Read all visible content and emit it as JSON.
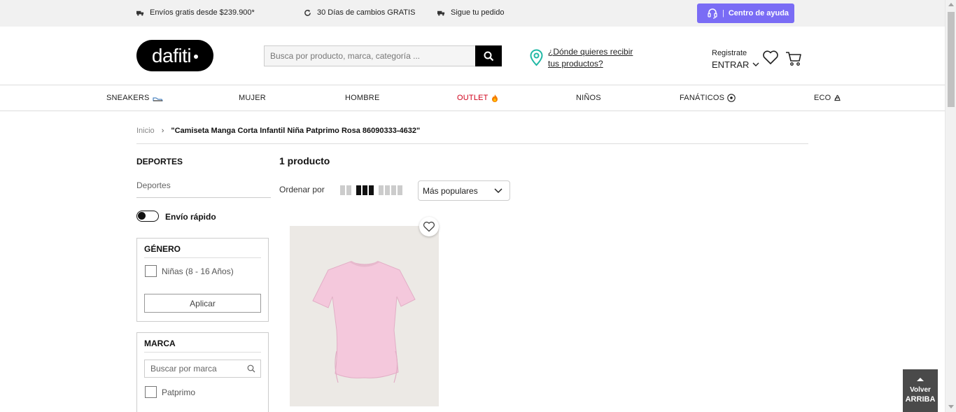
{
  "topbar": {
    "shipping": "Envíos gratis desde $239.900*",
    "returns": "30 Días de cambios GRATIS",
    "tracking": "Sigue tu pedido",
    "help_label": "Centro de ayuda",
    "help_sep": "|"
  },
  "header": {
    "logo": "dafiti",
    "search_placeholder": "Busca por producto, marca, categoría ...",
    "location_line1": "¿Dónde quieres recibir",
    "location_line2": "tus productos?",
    "account_small": "Registrate",
    "account_big": "ENTRAR"
  },
  "nav": {
    "items": [
      "SNEAKERS",
      "MUJER",
      "HOMBRE",
      "OUTLET",
      "NIÑOS",
      "FANÁTICOS",
      "ECO"
    ]
  },
  "breadcrumb": {
    "home": "Inicio",
    "separator": "›",
    "current": "\"Camiseta Manga Corta Infantil Niña Patprimo Rosa 86090333-4632\""
  },
  "sidebar": {
    "title": "DEPORTES",
    "subcategory": "Deportes",
    "fast_shipping": "Envío rápido",
    "gender": {
      "title": "GÉNERO",
      "options": [
        "Niñas (8 - 16 Años)"
      ],
      "apply": "Aplicar"
    },
    "brand": {
      "title": "MARCA",
      "search_placeholder": "Buscar por marca",
      "options": [
        "Patprimo"
      ]
    }
  },
  "main": {
    "count": "1 producto",
    "sort_label": "Ordenar por",
    "sort_value": "Más populares"
  },
  "back_to_top": {
    "line1": "Volver",
    "line2": "ARRIBA"
  },
  "colors": {
    "help_button": "#7a6cf5",
    "outlet": "#d0021b",
    "product_bg": "#ece9e5",
    "shirt": "#f4c8dc"
  }
}
